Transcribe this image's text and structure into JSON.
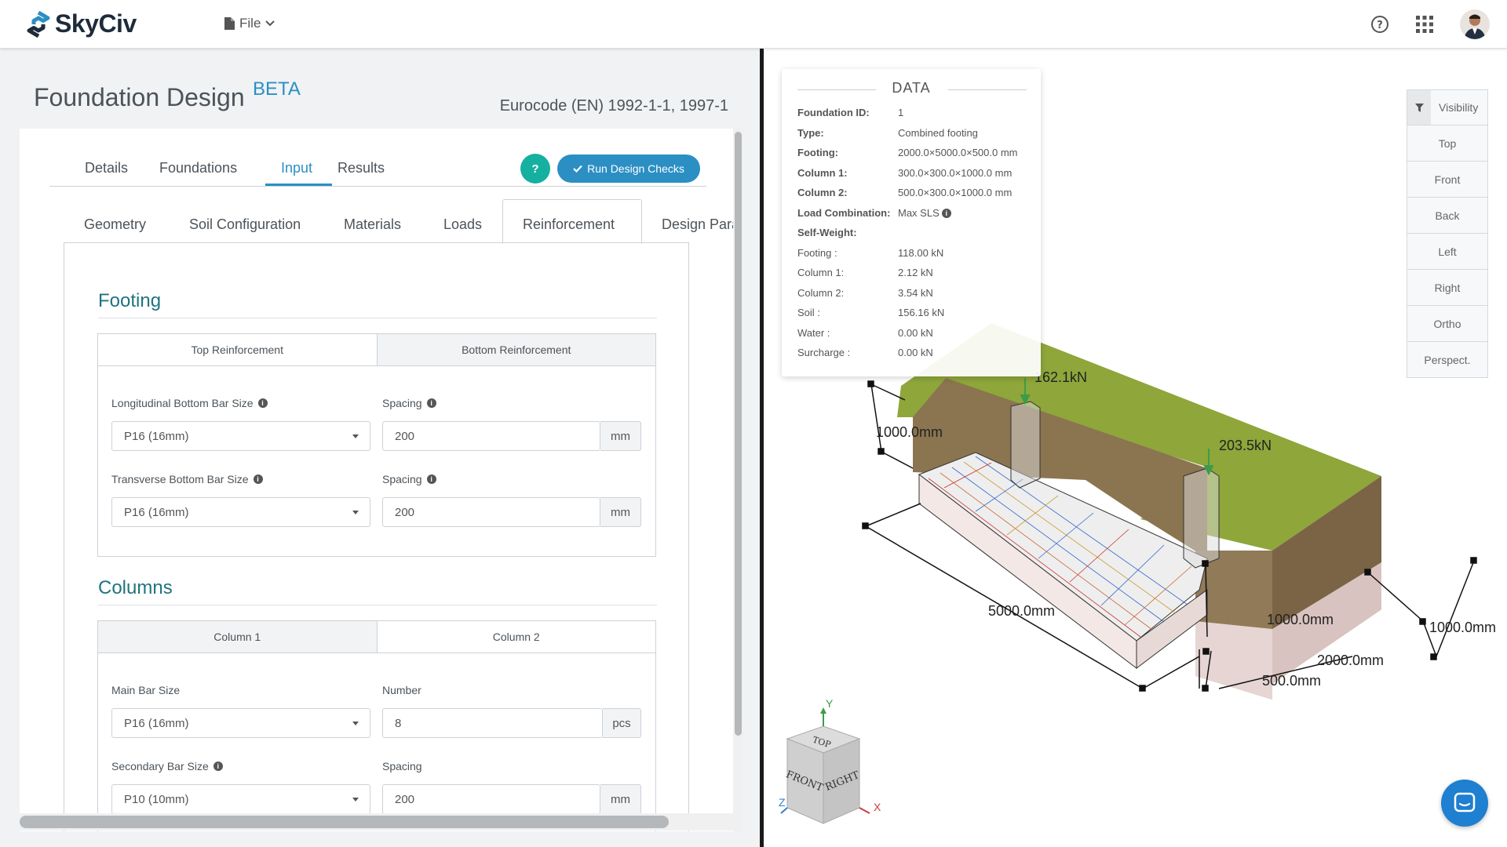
{
  "app": {
    "name": "SkyCiv",
    "file_menu": "File"
  },
  "header": {
    "title": "Foundation Design",
    "badge": "BETA",
    "code": "Eurocode (EN) 1992-1-1, 1997-1"
  },
  "main_tabs": [
    {
      "label": "Details"
    },
    {
      "label": "Foundations"
    },
    {
      "label": "Input"
    },
    {
      "label": "Results"
    }
  ],
  "buttons": {
    "help": "?",
    "run": "Run Design Checks"
  },
  "input_tabs": [
    {
      "label": "Geometry"
    },
    {
      "label": "Soil Configuration"
    },
    {
      "label": "Materials"
    },
    {
      "label": "Loads"
    },
    {
      "label": "Reinforcement"
    },
    {
      "label": "Design Para"
    }
  ],
  "footing": {
    "title": "Footing",
    "subtabs": [
      "Top Reinforcement",
      "Bottom Reinforcement"
    ],
    "long_label": "Longitudinal Bottom Bar Size",
    "long_value": "P16 (16mm)",
    "spacing_label": "Spacing",
    "long_spacing": "200",
    "trans_label": "Transverse Bottom Bar Size",
    "trans_value": "P16 (16mm)",
    "trans_spacing": "200",
    "unit": "mm"
  },
  "columns": {
    "title": "Columns",
    "subtabs": [
      "Column 1",
      "Column 2"
    ],
    "main_label": "Main Bar Size",
    "main_value": "P16 (16mm)",
    "number_label": "Number",
    "number_value": "8",
    "number_unit": "pcs",
    "secondary_label": "Secondary Bar Size",
    "secondary_value": "P10 (10mm)",
    "spacing_label": "Spacing",
    "spacing_value": "200",
    "unit": "mm"
  },
  "data_panel": {
    "title": "DATA",
    "rows": [
      {
        "k": "Foundation ID:",
        "v": "1",
        "bold": true
      },
      {
        "k": "Type:",
        "v": "Combined footing",
        "bold": true
      },
      {
        "k": "Footing:",
        "v": "2000.0×5000.0×500.0 mm",
        "bold": true
      },
      {
        "k": "Column 1:",
        "v": "300.0×300.0×1000.0 mm",
        "bold": true
      },
      {
        "k": "Column 2:",
        "v": "500.0×300.0×1000.0 mm",
        "bold": true
      },
      {
        "k": "Load Combination:",
        "v": "Max SLS",
        "bold": true
      },
      {
        "k": "Self-Weight:",
        "v": "",
        "bold": true
      },
      {
        "k": "Footing :",
        "v": "118.00 kN",
        "bold": false
      },
      {
        "k": "Column 1:",
        "v": "2.12 kN",
        "bold": false
      },
      {
        "k": "Column 2:",
        "v": "3.54 kN",
        "bold": false
      },
      {
        "k": "Soil :",
        "v": "156.16 kN",
        "bold": false
      },
      {
        "k": "Water :",
        "v": "0.00 kN",
        "bold": false
      },
      {
        "k": "Surcharge :",
        "v": "0.00 kN",
        "bold": false
      }
    ]
  },
  "view_buttons": [
    "Visibility",
    "Top",
    "Front",
    "Back",
    "Left",
    "Right",
    "Ortho",
    "Perspect."
  ],
  "model_labels": {
    "load1": "162.1kN",
    "load2": "203.5kN",
    "dim_1000a": "1000.0mm",
    "dim_5000": "5000.0mm",
    "dim_1000b": "1000.0mm",
    "dim_1000c": "1000.0mm",
    "dim_2000": "2000.0mm",
    "dim_500": "500.0mm"
  },
  "navcube": {
    "top": "TOP",
    "front": "FRONT",
    "right": "RIGHT",
    "axis_y": "Y",
    "axis_x": "X",
    "axis_z": "Z"
  },
  "colors": {
    "accent": "#2b8fc4",
    "teal": "#16b0a0",
    "section": "#20747f",
    "grass": "#8ea63a",
    "soil": "#8a7550"
  }
}
